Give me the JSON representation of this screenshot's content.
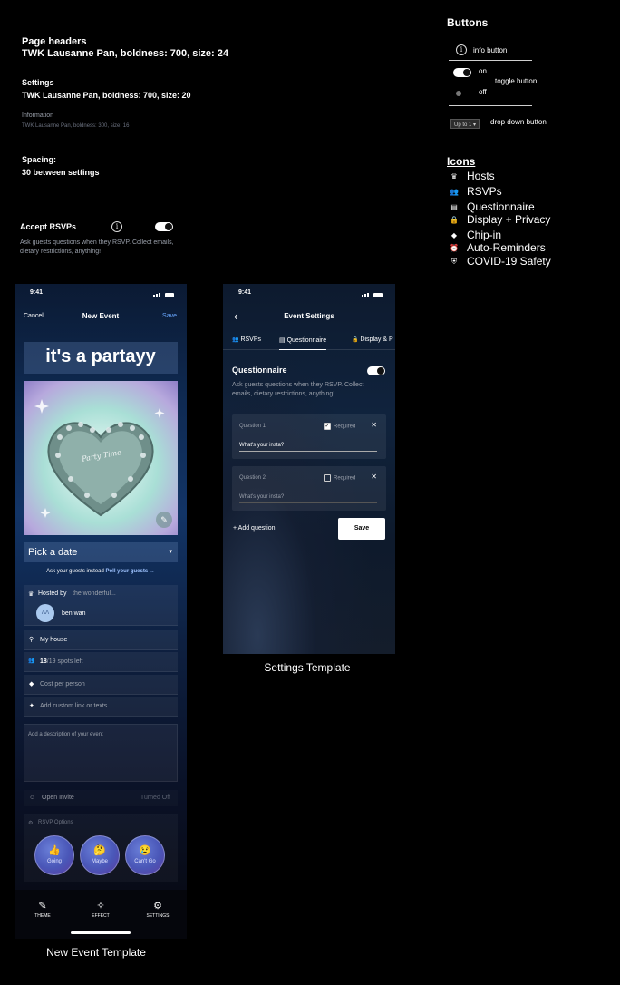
{
  "typography": {
    "page_headers_label": "Page headers",
    "page_headers_spec": "TWK Lausanne Pan, boldness: 700, size: 24",
    "settings_label": "Settings",
    "settings_spec": "TWK Lausanne Pan, boldness: 700, size: 20",
    "information_label": "Information",
    "information_spec": "TWK Lausanne Pan, boldness: 300, size: 16",
    "spacing_label": "Spacing:",
    "spacing_spec": "30 between settings"
  },
  "example_setting": {
    "title": "Accept RSVPs",
    "info_glyph": "i",
    "description": "Ask guests questions when they RSVP. Collect emails, dietary restrictions, anything!"
  },
  "buttons_legend": {
    "title": "Buttons",
    "info_glyph": "i",
    "info_button_label": "info button",
    "on_label": "on",
    "off_label": "off",
    "toggle_button_label": "toggle button",
    "dropdown_value": "Up to 1",
    "dropdown_button_label": "drop down button"
  },
  "icons_legend": {
    "title": "Icons",
    "items": [
      {
        "icon": "crown-icon",
        "glyph": "♛",
        "label": "Hosts"
      },
      {
        "icon": "people-icon",
        "glyph": "👥",
        "label": "RSVPs"
      },
      {
        "icon": "form-icon",
        "glyph": "▤",
        "label": "Questionnaire"
      },
      {
        "icon": "lock-icon",
        "glyph": "🔒",
        "label": "Display + Privacy"
      },
      {
        "icon": "tag-icon",
        "glyph": "◆",
        "label": "Chip-in"
      },
      {
        "icon": "alarm-icon",
        "glyph": "⏰",
        "label": "Auto-Reminders"
      },
      {
        "icon": "shield-icon",
        "glyph": "⛨",
        "label": "COVID-19 Safety"
      }
    ]
  },
  "new_event": {
    "time": "9:41",
    "cancel": "Cancel",
    "title": "New Event",
    "save": "Save",
    "event_name": "it's a partayy",
    "cake_text": "Party Time",
    "pick_date": "Pick a date",
    "poll_prefix": "Ask your guests instead",
    "poll_link": "Poll your guests →",
    "hosted_by": "Hosted by",
    "hosted_by_placeholder": "the wonderful...",
    "host_initials": "ᐱᐱ",
    "host_name": "ben wan",
    "location": "My house",
    "spots_count": "18",
    "spots_rest": "/19 spots left",
    "cost_placeholder": "Cost per person",
    "custom_link_placeholder": "Add custom link or texts",
    "description_placeholder": "Add a description of your event",
    "open_invite": "Open Invite",
    "open_invite_state": "Turned Off",
    "rsvp_options": "RSVP Options",
    "rsvp_going": "Going",
    "rsvp_maybe": "Maybe",
    "rsvp_cant": "Can't Go",
    "tab_theme": "THEME",
    "tab_effect": "EFFECT",
    "tab_settings": "SETTINGS",
    "caption": "New Event Template"
  },
  "event_settings": {
    "time": "9:41",
    "back": "‹",
    "title": "Event Settings",
    "tabs": [
      {
        "icon": "people-icon",
        "glyph": "👥",
        "label": "RSVPs"
      },
      {
        "icon": "form-icon",
        "glyph": "▤",
        "label": "Questionnaire"
      },
      {
        "icon": "lock-icon",
        "glyph": "🔒",
        "label": "Display & P"
      }
    ],
    "section_title": "Questionnaire",
    "section_desc": "Ask guests questions when they RSVP. Collect emails, dietary restrictions, anything!",
    "questions": [
      {
        "label": "Question 1",
        "required_label": "Required",
        "required": true,
        "answer": "What's your insta?"
      },
      {
        "label": "Question 2",
        "required_label": "Required",
        "required": false,
        "answer": "What's your insta?"
      }
    ],
    "add_question": "+ Add question",
    "save": "Save",
    "caption": "Settings Template"
  }
}
